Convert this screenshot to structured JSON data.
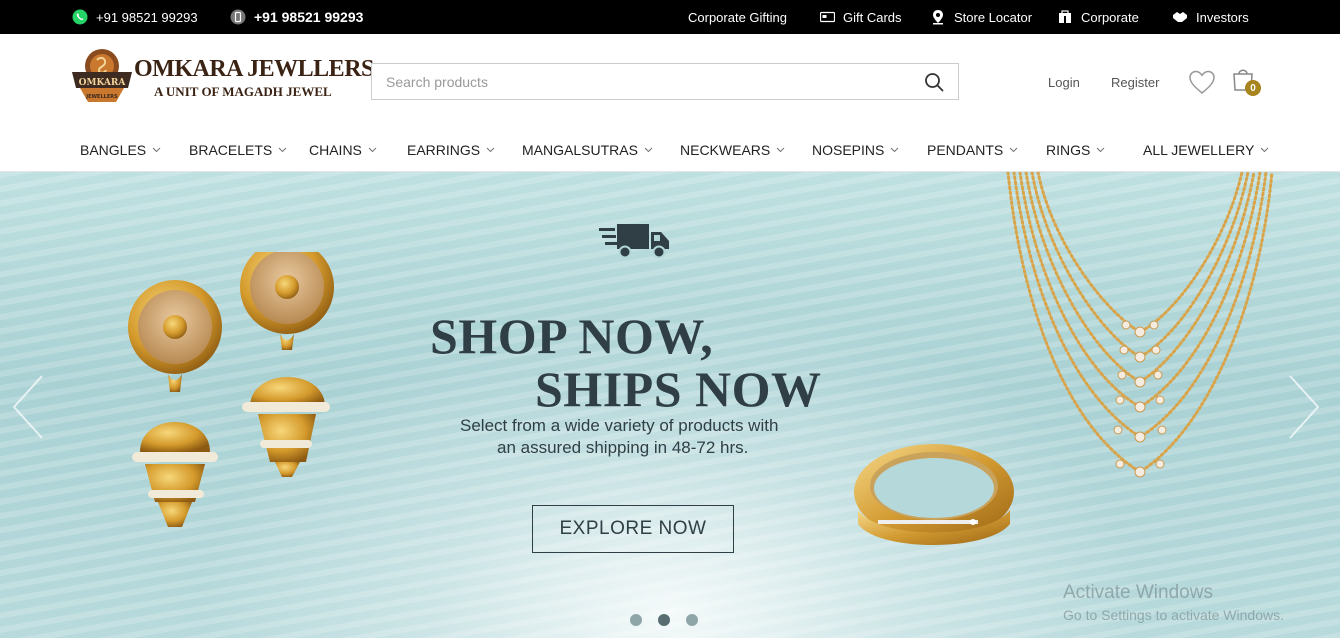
{
  "topbar": {
    "whatsapp_icon": "whatsapp-icon",
    "whatsapp_phone": "+91 98521 99293",
    "mobile_icon": "mobile-phone-icon",
    "call_phone": "+91 98521 99293",
    "links": [
      {
        "label": "Corporate Gifting",
        "icon": ""
      },
      {
        "label": "Gift Cards",
        "icon": "gift-card-icon"
      },
      {
        "label": "Store Locator",
        "icon": "location-pin-icon"
      },
      {
        "label": "Corporate",
        "icon": "building-icon"
      },
      {
        "label": "Investors",
        "icon": "handshake-icon"
      }
    ]
  },
  "header": {
    "brand": "OMKARA JEWLLERS",
    "tagline": "A UNIT OF MAGADH JEWEL",
    "logo_badge": "OMKARA",
    "logo_badge_sub": "JEWELLERS",
    "search_placeholder": "Search products",
    "search_value": "",
    "login_label": "Login",
    "register_label": "Register",
    "cart_count": "0"
  },
  "nav": {
    "items": [
      {
        "label": "BANGLES"
      },
      {
        "label": "BRACELETS"
      },
      {
        "label": "CHAINS"
      },
      {
        "label": "EARRINGS"
      },
      {
        "label": "MANGALSUTRAS"
      },
      {
        "label": "NECKWEARS"
      },
      {
        "label": "NOSEPINS"
      },
      {
        "label": "PENDANTS"
      },
      {
        "label": "RINGS"
      },
      {
        "label": "ALL JEWELLERY"
      }
    ]
  },
  "hero": {
    "headline_line1": "SHOP NOW,",
    "headline_line2": "SHIPS NOW",
    "subtext_line1": "Select from a wide variety of products with",
    "subtext_line2": "an assured shipping in 48-72 hrs.",
    "cta_label": "EXPLORE NOW",
    "active_slide": 2,
    "slide_count": 3
  },
  "watermark": {
    "line1": "Activate Windows",
    "line2": "Go to Settings to activate Windows."
  },
  "colors": {
    "topbar_bg": "#000000",
    "hero_text": "#2f3f45",
    "cart_badge": "#a8841e",
    "hero_bg": "#b3d7d9"
  }
}
